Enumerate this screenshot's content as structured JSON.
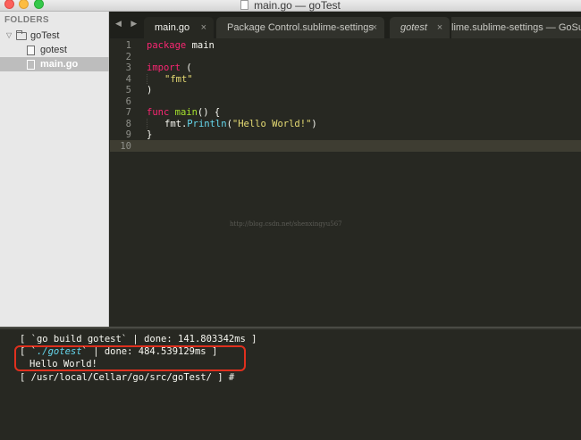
{
  "window": {
    "title": "main.go — goTest"
  },
  "sidebar": {
    "header": "FOLDERS",
    "folder": {
      "disclosure": "▽",
      "label": "goTest"
    },
    "files": [
      {
        "label": "gotest",
        "selected": false
      },
      {
        "label": "main.go",
        "selected": true
      }
    ]
  },
  "tabs": {
    "nav": "◀ ▶",
    "items": [
      {
        "label": "main.go",
        "close": "×",
        "active": true
      },
      {
        "label": "Package Control.sublime-settings",
        "close": "×",
        "active": false
      },
      {
        "label": "gotest",
        "close": "×",
        "active": false
      },
      {
        "label": "lime.sublime-settings — GoSubli",
        "active": false
      }
    ]
  },
  "editor": {
    "line_numbers": [
      "1",
      "2",
      "3",
      "4",
      "5",
      "6",
      "7",
      "8",
      "9",
      "10"
    ],
    "current_line": 10,
    "code": {
      "l1_kw": "package",
      "l1_rest": " main",
      "l3_kw": "import",
      "l3_rest": " (",
      "l4_str": "\"fmt\"",
      "l5": ")",
      "l7_kw": "func",
      "l7_fn": " main",
      "l7_rest": "() {",
      "l8_pkg": "fmt.",
      "l8_fn": "Println",
      "l8_open": "(",
      "l8_str": "\"Hello World!\"",
      "l8_close": ")",
      "l9": "}"
    },
    "watermark": "http://blog.csdn.net/shenxingyu567"
  },
  "console": {
    "line1": "[ `go build gotest` | done: 141.803342ms ]",
    "line2_pre": "[ `",
    "line2_cmd": "./gotest",
    "line2_post": "` | done: 484.539129ms ]",
    "line3": "Hello World!",
    "line4": "[ /usr/local/Cellar/go/src/goTest/ ] #"
  },
  "colors": {
    "highlight_box": "#e0301e",
    "keyword": "#f92672",
    "function": "#a6e22e",
    "string": "#e6db74",
    "builtin": "#66d9ef"
  }
}
